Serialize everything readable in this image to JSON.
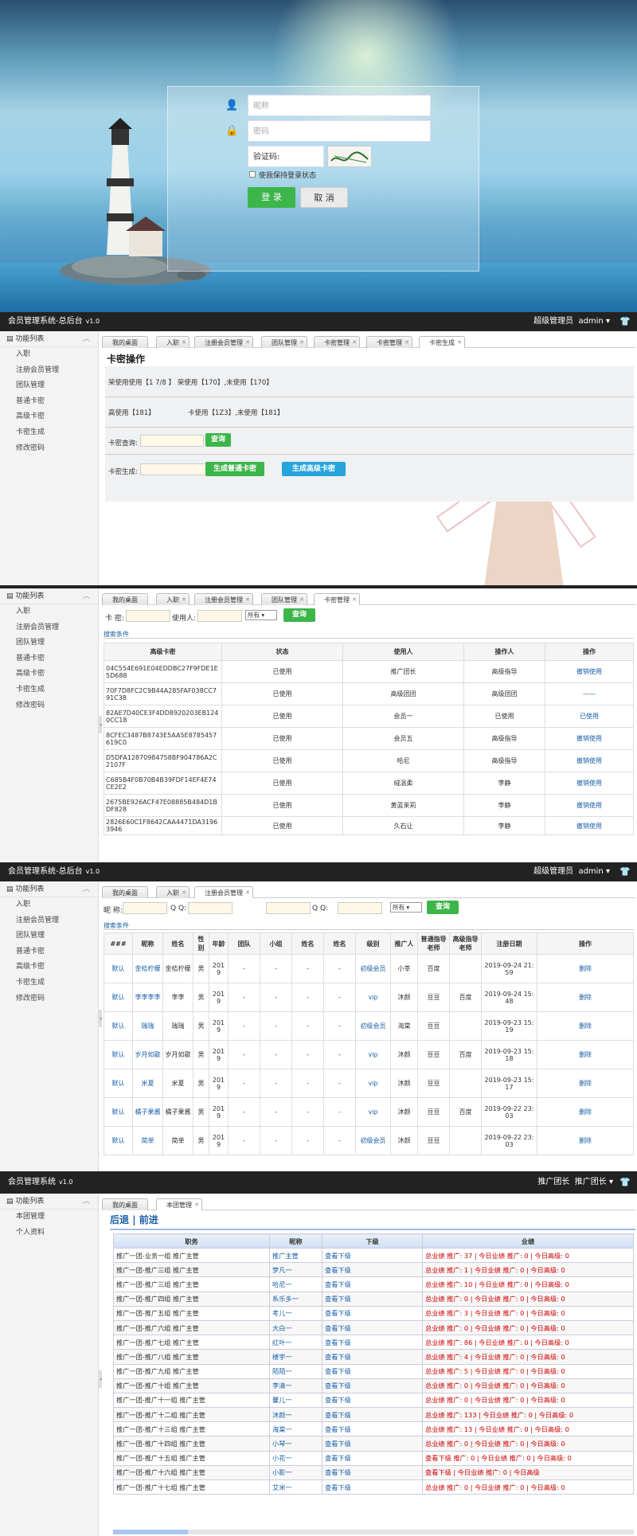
{
  "login": {
    "username_placeholder": "昵称",
    "password_placeholder": "密码",
    "captcha_label": "验证码:",
    "remember_label": "使我保持登录状态",
    "login_button": "登 录",
    "cancel_button": "取 消"
  },
  "header": {
    "title": "会员管理系统-总后台",
    "version": "v1.0",
    "role": "超级管理员",
    "user": "admin",
    "caret": "▾",
    "shirt": "👕"
  },
  "header4": {
    "title": "会员管理系统",
    "version": "v1.0",
    "role": "推广团长",
    "user": "推广团长",
    "caret": "▾"
  },
  "sidebar": {
    "title": "功能列表",
    "items": [
      "入职",
      "注册会员管理",
      "团队管理",
      "普通卡密",
      "高级卡密",
      "卡密生成",
      "修改密码"
    ]
  },
  "sidebar4": {
    "title": "功能列表",
    "items": [
      "本团管理",
      "个人资料"
    ]
  },
  "tabs1": [
    "我的桌面",
    "入职",
    "注册会员管理",
    "团队管理",
    "卡密管理",
    "卡密管理",
    "卡密生成"
  ],
  "tabs2": [
    "我的桌面",
    "入职",
    "注册会员管理",
    "团队管理",
    "卡密管理"
  ],
  "tabs3": [
    "我的桌面",
    "入职",
    "注册会员管理"
  ],
  "tabs4": [
    "我的桌面",
    "本团管理"
  ],
  "card_op": {
    "title": "卡密操作",
    "row1": "荣使用使用【1 7/8 】 荣使用【170】,未使用【170】",
    "row2a": "高使用【181】",
    "row2b": "卡使用【1Z3】,未使用【181】",
    "query_label": "卡密查询:",
    "query_button": "查询",
    "gen_label": "卡密生成:",
    "gen_normal": "生成普通卡密",
    "gen_high": "生成高级卡密"
  },
  "card_list": {
    "card_label": "卡 密:",
    "user_label": "使用人:",
    "select_value": "所有",
    "query_button": "查询",
    "search_cond": "搜索条件",
    "headers": [
      "高级卡密",
      "状态",
      "使用人",
      "操作人",
      "操作"
    ],
    "rows": [
      [
        "04C554E691E04EDDBC27F9FDE1E5D688",
        "已使用",
        "推广团长",
        "高级指导",
        "撤销使用"
      ],
      [
        "70F7D8FC2C9B44A285FAF038CC791C38",
        "已使用",
        "高级团团",
        "高级团团",
        "——"
      ],
      [
        "82AE7D40CE3F4DD8920203EB1240CC18",
        "已使用",
        "会员一",
        "已使用",
        "已使用"
      ],
      [
        "8CFEC3487B8743E5AA5E8785457619C0",
        "已使用",
        "会员五",
        "高级指导",
        "撤销使用"
      ],
      [
        "D5DFA12870984758BF904786A2C2107F",
        "已使用",
        "哈尼",
        "高级指导",
        "撤销使用"
      ],
      [
        "C685B4F0B70B4B39FDF14EF4E74CE2E2",
        "已使用",
        "绒温柔",
        "李静",
        "撤销使用"
      ],
      [
        "2675BE926ACF47E08885B484D1BDF828",
        "已使用",
        "黄蓝茉莉",
        "李静",
        "撤销使用"
      ],
      [
        "2826E60C1F8642CAA4471DA31963946",
        "已使用",
        "久石让",
        "李静",
        "撤销使用"
      ]
    ]
  },
  "member_list": {
    "nick_label": "昵 称:",
    "qq_label": "Q Q:",
    "qq_label2": "Q Q:",
    "select_value": "所有",
    "query_button": "查询",
    "search_cond": "搜索条件",
    "headers": [
      "###",
      "昵称",
      "姓名",
      "性别",
      "年龄",
      "团队",
      "小组",
      "姓名",
      "姓名",
      "级别",
      "推广人",
      "普通指导老师",
      "高级指导老师",
      "注册日期",
      "操作"
    ],
    "rows": [
      [
        "默认",
        "金桔柠檬",
        "金桔柠檬",
        "男",
        "2019",
        "-",
        "-",
        "-",
        "-",
        "初级会员",
        "小莘",
        "百度",
        "",
        "2019-09-24 21:59",
        "删除"
      ],
      [
        "默认",
        "李李李李",
        "李李",
        "男",
        "2019",
        "-",
        "-",
        "-",
        "-",
        "vip",
        "沐颜",
        "豆豆",
        "百度",
        "2019-09-24 15:48",
        "删除"
      ],
      [
        "默认",
        "瑞瑞",
        "瑞瑞",
        "男",
        "2019",
        "-",
        "-",
        "-",
        "-",
        "初级会员",
        "海棠",
        "豆豆",
        "",
        "2019-09-23 15:19",
        "删除"
      ],
      [
        "默认",
        "岁月如歌",
        "岁月如歌",
        "男",
        "2019",
        "-",
        "-",
        "-",
        "-",
        "vip",
        "沐颜",
        "豆豆",
        "百度",
        "2019-09-23 15:18",
        "删除"
      ],
      [
        "默认",
        "米夏",
        "米夏",
        "男",
        "2019",
        "-",
        "-",
        "-",
        "-",
        "vip",
        "沐颜",
        "豆豆",
        "",
        "2019-09-23 15:17",
        "删除"
      ],
      [
        "默认",
        "橘子果酱",
        "橘子果酱",
        "男",
        "2019",
        "-",
        "-",
        "-",
        "-",
        "vip",
        "沐颜",
        "豆豆",
        "百度",
        "2019-09-22 23:03",
        "删除"
      ],
      [
        "默认",
        "简单",
        "简单",
        "男",
        "2019",
        "-",
        "-",
        "-",
        "-",
        "初级会员",
        "沐颜",
        "豆豆",
        "",
        "2019-09-22 23:03",
        "删除"
      ]
    ]
  },
  "team": {
    "nav_back": "后退",
    "nav_sep": "|",
    "nav_fwd": "前进",
    "headers": [
      "职务",
      "昵称",
      "下级",
      "业绩"
    ],
    "rows": [
      [
        "推广一团-业务一组 推广主管",
        "推广主管",
        "查看下级",
        "总业绩 推广: 37 | 今日业绩 推广: 0 | 今日高级: 0"
      ],
      [
        "推广一团-推广三组 推广主管",
        "梦凡一",
        "查看下级",
        "总业绩 推广: 1 | 今日业绩 推广: 0 | 今日高级: 0"
      ],
      [
        "推广一团-推广三组 推广主管",
        "哈尼一",
        "查看下级",
        "总业绩 推广: 10 | 今日业绩 推广: 0 | 今日高级: 0"
      ],
      [
        "推广一团-推广四组 推广主管",
        "系乐多一",
        "查看下级",
        "总业绩 推广: 0 | 今日业绩 推广: 0 | 今日高级: 0"
      ],
      [
        "推广一团-推广五组 推广主管",
        "考儿一",
        "查看下级",
        "总业绩 推广: 3 | 今日业绩 推广: 0 | 今日高级: 0"
      ],
      [
        "推广一团-推广六组 推广主管",
        "大白一",
        "查看下级",
        "总业绩 推广: 0 | 今日业绩 推广: 0 | 今日高级: 0"
      ],
      [
        "推广一团-推广七组 推广主管",
        "红叶一",
        "查看下级",
        "总业绩 推广: 86 | 今日业绩 推广: 0 | 今日高级: 0"
      ],
      [
        "推广一团-推广八组 推广主管",
        "楼宇一",
        "查看下级",
        "总业绩 推广: 4 | 今日业绩 推广: 0 | 今日高级: 0"
      ],
      [
        "推广一团-推广九组 推广主管",
        "陌陌一",
        "查看下级",
        "总业绩 推广: 5 | 今日业绩 推广: 0 | 今日高级: 0"
      ],
      [
        "推广一团-推广十组 推广主管",
        "李清一",
        "查看下级",
        "总业绩 推广: 0 | 今日业绩 推广: 0 | 今日高级: 0"
      ],
      [
        "推广一团-推广十一组 推广主管",
        "馨儿一",
        "查看下级",
        "总业绩 推广: 0 | 今日业绩 推广: 0 | 今日高级: 0"
      ],
      [
        "推广一团-推广十二组 推广主管",
        "沐颜一",
        "查看下级",
        "总业绩 推广: 133 | 今日业绩 推广: 0 | 今日高级: 0"
      ],
      [
        "推广一团-推广十三组 推广主管",
        "海棠一",
        "查看下级",
        "总业绩 推广: 13 | 今日业绩 推广: 0 | 今日高级: 0"
      ],
      [
        "推广一团-推广十四组 推广主管",
        "小琴一",
        "查看下级",
        "总业绩 推广: 0 | 今日业绩 推广: 0 | 今日高级: 0"
      ],
      [
        "推广一团-推广十五组 推广主管",
        "小花一",
        "查看下级",
        "查看下级 推广: 0 | 今日业绩 推广: 0 | 今日高级: 0"
      ],
      [
        "推广一团-推广十六组 推广主管",
        "小影一",
        "查看下级",
        "查看下级 | 今日业绩 推广: 0 | 今日高级"
      ],
      [
        "推广一团-推广十七组 推广主管",
        "艾米一",
        "查看下级",
        "总业绩 推广: 0 | 今日业绩 推广: 0 | 今日高级: 0"
      ]
    ]
  }
}
